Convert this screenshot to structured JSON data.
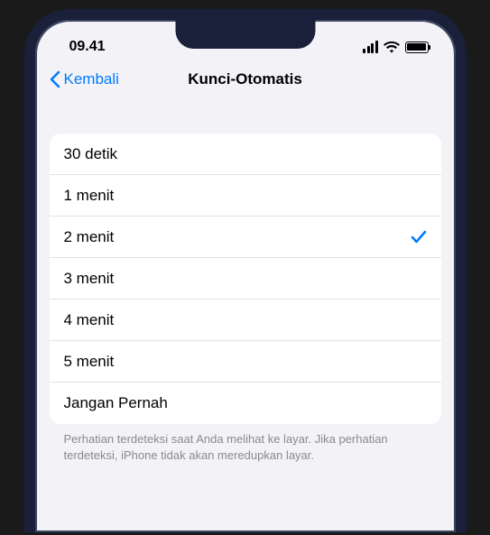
{
  "status": {
    "time": "09.41"
  },
  "nav": {
    "back_label": "Kembali",
    "title": "Kunci-Otomatis"
  },
  "options": [
    {
      "label": "30 detik",
      "selected": false
    },
    {
      "label": "1 menit",
      "selected": false
    },
    {
      "label": "2 menit",
      "selected": true
    },
    {
      "label": "3 menit",
      "selected": false
    },
    {
      "label": "4 menit",
      "selected": false
    },
    {
      "label": "5 menit",
      "selected": false
    },
    {
      "label": "Jangan Pernah",
      "selected": false
    }
  ],
  "footer": "Perhatian terdeteksi saat Anda melihat ke layar. Jika perhatian terdeteksi, iPhone tidak akan meredupkan layar."
}
